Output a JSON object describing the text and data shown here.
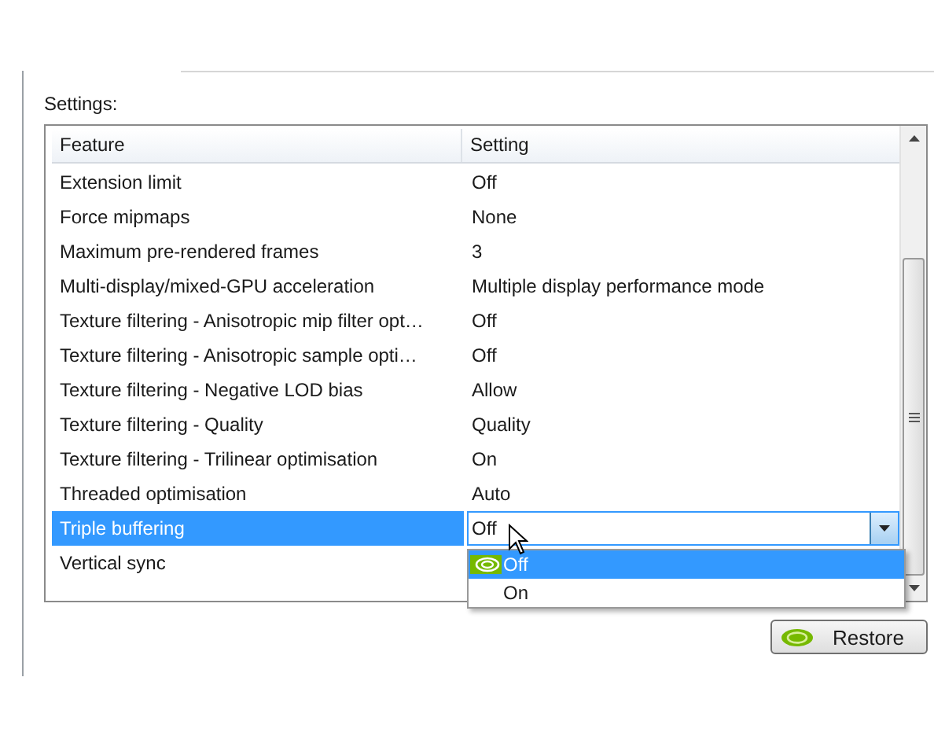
{
  "settings_label": "Settings:",
  "table": {
    "columns": [
      "Feature",
      "Setting"
    ],
    "rows": [
      {
        "feature": "Extension limit",
        "setting": "Off",
        "selected": false
      },
      {
        "feature": "Force mipmaps",
        "setting": "None",
        "selected": false
      },
      {
        "feature": "Maximum pre-rendered frames",
        "setting": "3",
        "selected": false
      },
      {
        "feature": "Multi-display/mixed-GPU acceleration",
        "setting": "Multiple display performance mode",
        "selected": false
      },
      {
        "feature": "Texture filtering - Anisotropic mip filter opt…",
        "setting": "Off",
        "selected": false
      },
      {
        "feature": "Texture filtering - Anisotropic sample opti…",
        "setting": "Off",
        "selected": false
      },
      {
        "feature": "Texture filtering - Negative LOD bias",
        "setting": "Allow",
        "selected": false
      },
      {
        "feature": "Texture filtering - Quality",
        "setting": "Quality",
        "selected": false
      },
      {
        "feature": "Texture filtering - Trilinear optimisation",
        "setting": "On",
        "selected": false
      },
      {
        "feature": "Threaded optimisation",
        "setting": "Auto",
        "selected": false
      },
      {
        "feature": "Triple buffering",
        "setting": "Off",
        "selected": true
      },
      {
        "feature": "Vertical sync",
        "selected": false
      }
    ]
  },
  "dropdown": {
    "options": [
      {
        "label": "Off",
        "selected": true
      },
      {
        "label": "On",
        "selected": false
      }
    ]
  },
  "restore_button": "Restore"
}
